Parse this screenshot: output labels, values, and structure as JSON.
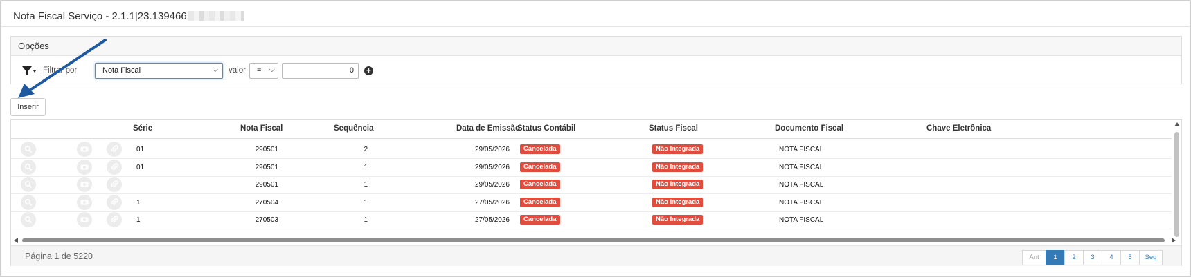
{
  "window": {
    "title": "Nota Fiscal Serviço - 2.1.1|23.139466"
  },
  "options": {
    "heading": "Opções",
    "filter_label": "Filtrar por",
    "filter_field": "Nota Fiscal",
    "valor_label": "valor",
    "operator": "=",
    "value": "0",
    "icons": {
      "filter": "filter-icon",
      "add": "plus-circle-icon"
    }
  },
  "toolbar": {
    "insert_label": "Inserir"
  },
  "table": {
    "headers": {
      "serie": "Série",
      "nota_fiscal": "Nota Fiscal",
      "sequencia": "Sequência",
      "data_emissao": "Data de Emissão",
      "status_contabil": "Status Contábil",
      "status_fiscal": "Status Fiscal",
      "documento_fiscal": "Documento Fiscal",
      "chave_eletronica": "Chave Eletrônica"
    },
    "row_icons": [
      "search-icon",
      "view-icon",
      "attachment-icon"
    ],
    "rows": [
      {
        "serie": "01",
        "nota_fiscal": "290501",
        "sequencia": "2",
        "data_emissao": "29/05/2026",
        "status_contabil": "Cancelada",
        "status_fiscal": "Não Integrada",
        "documento_fiscal": "NOTA FISCAL",
        "chave_eletronica": ""
      },
      {
        "serie": "01",
        "nota_fiscal": "290501",
        "sequencia": "1",
        "data_emissao": "29/05/2026",
        "status_contabil": "Cancelada",
        "status_fiscal": "Não Integrada",
        "documento_fiscal": "NOTA FISCAL",
        "chave_eletronica": ""
      },
      {
        "serie": "",
        "nota_fiscal": "290501",
        "sequencia": "1",
        "data_emissao": "29/05/2026",
        "status_contabil": "Cancelada",
        "status_fiscal": "Não Integrada",
        "documento_fiscal": "NOTA FISCAL",
        "chave_eletronica": ""
      },
      {
        "serie": "1",
        "nota_fiscal": "270504",
        "sequencia": "1",
        "data_emissao": "27/05/2026",
        "status_contabil": "Cancelada",
        "status_fiscal": "Não Integrada",
        "documento_fiscal": "NOTA FISCAL",
        "chave_eletronica": ""
      },
      {
        "serie": "1",
        "nota_fiscal": "270503",
        "sequencia": "1",
        "data_emissao": "27/05/2026",
        "status_contabil": "Cancelada",
        "status_fiscal": "Não Integrada",
        "documento_fiscal": "NOTA FISCAL",
        "chave_eletronica": ""
      }
    ],
    "status_color": "#e04d3e"
  },
  "pagination": {
    "info": "Página 1 de 5220",
    "prev": "Ant",
    "pages": [
      "1",
      "2",
      "3",
      "4",
      "5"
    ],
    "active_page": "1",
    "next": "Seg",
    "accent": "#337ab7"
  },
  "annotation": {
    "arrow_color": "#1f5aa0"
  }
}
